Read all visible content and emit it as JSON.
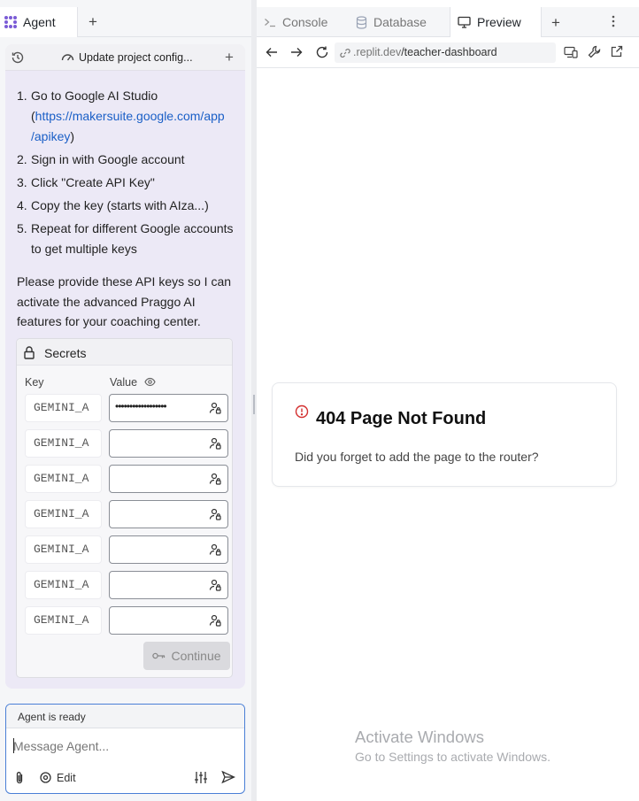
{
  "left": {
    "tab_label": "Agent",
    "card_title": "Update project config...",
    "steps": [
      {
        "n": "1.",
        "before": "Go to Google AI Studio (",
        "link": "https://makersuite.google.com/app/apikey",
        "after": ")"
      },
      {
        "n": "2.",
        "text": "Sign in with Google account"
      },
      {
        "n": "3.",
        "text": "Click \"Create API Key\""
      },
      {
        "n": "4.",
        "text": "Copy the key (starts with AIza...)"
      },
      {
        "n": "5.",
        "text": "Repeat for different Google accounts to get multiple keys"
      }
    ],
    "link_line1": "https://makersuite.google.com/app",
    "link_line2": "/apikey",
    "paragraph": "Please provide these API keys so I can activate the advanced Praggo AI features for your coaching center.",
    "secrets": {
      "title": "Secrets",
      "key_header": "Key",
      "value_header": "Value",
      "rows": [
        {
          "key": "GEMINI_A",
          "value": "••••••••••••••••••"
        },
        {
          "key": "GEMINI_A",
          "value": ""
        },
        {
          "key": "GEMINI_A",
          "value": ""
        },
        {
          "key": "GEMINI_A",
          "value": ""
        },
        {
          "key": "GEMINI_A",
          "value": ""
        },
        {
          "key": "GEMINI_A",
          "value": ""
        },
        {
          "key": "GEMINI_A",
          "value": ""
        }
      ],
      "continue_label": "Continue"
    },
    "status": "Agent is ready",
    "message_placeholder": "Message Agent...",
    "edit_label": "Edit"
  },
  "right": {
    "tabs": [
      {
        "label": "Console",
        "icon": "terminal-icon"
      },
      {
        "label": "Database",
        "icon": "database-icon"
      },
      {
        "label": "Preview",
        "icon": "monitor-icon"
      }
    ],
    "url_host": ".replit.dev",
    "url_path": "/teacher-dashboard",
    "not_found_title": "404 Page Not Found",
    "not_found_desc": "Did you forget to add the page to the router?",
    "watermark_title": "Activate Windows",
    "watermark_sub": "Go to Settings to activate Windows."
  },
  "colors": {
    "accent": "#4a7fd6",
    "link": "#1a5fc7",
    "alert": "#d32f2f",
    "card_bg": "#ece9f6"
  }
}
